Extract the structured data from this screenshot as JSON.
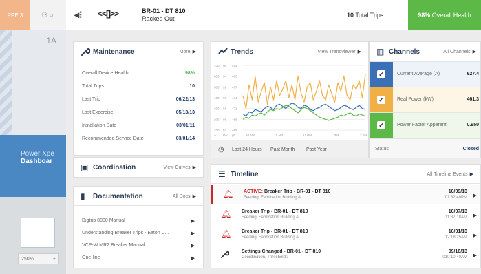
{
  "background": {
    "ppe_label": "PPE 3",
    "tab_icons": "⚇ ○",
    "tile_label": "1A",
    "dashboard_line1": "Power Xpe",
    "dashboard_line2": "Dashboar",
    "zoom_value": "250%",
    "zoom_plus": "+"
  },
  "header": {
    "back_icon": "◂⁝",
    "device_icon": "<<[]>>",
    "device_name": "BR-01 - DT 810",
    "device_status": "Racked Out",
    "total_trips_value": "10",
    "total_trips_label": "Total Trips",
    "health_value": "98%",
    "health_label": "Overall Health",
    "health_color": "#5cb947"
  },
  "maintenance": {
    "title": "Maintenance",
    "link": "More",
    "rows": [
      {
        "label": "Overall Device Health",
        "value": "98%"
      },
      {
        "label": "Total Trips",
        "value": "10"
      },
      {
        "label": "Last Trip",
        "value": "06/22/13"
      },
      {
        "label": "Last Excercise",
        "value": "05/13/13"
      },
      {
        "label": "Installation Date",
        "value": "03/01/11"
      },
      {
        "label": "Recommended Service Date",
        "value": "03/01/14"
      }
    ]
  },
  "coordination": {
    "title": "Coordination",
    "link": "View Curves"
  },
  "documentation": {
    "title": "Documentation",
    "link": "All Docs",
    "items": [
      "Digtrip 8000 Manual",
      "Understanding Breaker Trips - Eaton U...",
      "VCP-W MR2 Breaker Manual",
      "One-line"
    ]
  },
  "trends": {
    "title": "Trends",
    "link": "View Trendviewer",
    "ranges": [
      "Last 24 Hours",
      "Past Month",
      "Past Year"
    ],
    "y_ticks": [
      [
        "700",
        "96",
        "483"
      ],
      [
        "600",
        "94",
        "480"
      ],
      [
        "500",
        "92",
        "477"
      ],
      [
        "400",
        "90",
        "474"
      ],
      [
        "300",
        "88",
        "471"
      ],
      [
        "200",
        "86",
        "468"
      ],
      [
        "100",
        "84",
        "465"
      ]
    ],
    "x_axis_prefix": [
      "A",
      "kW",
      "pf"
    ],
    "x_ticks": [
      "10 AM",
      "11 AM",
      "12 PM",
      "1 PM",
      "2 PM"
    ]
  },
  "chart_data": {
    "type": "line",
    "x": [
      0,
      0.5,
      1,
      1.5,
      2,
      2.5,
      3,
      3.5,
      4,
      4.5,
      5,
      5.5,
      6,
      6.5,
      7,
      7.5,
      8,
      8.5,
      9,
      9.5,
      10,
      10.5,
      11,
      11.5,
      12,
      12.5,
      13,
      13.5,
      14,
      14.5,
      15,
      15.5,
      16,
      16.5,
      17,
      17.5,
      18,
      18.5,
      19,
      19.5,
      20
    ],
    "series": [
      {
        "color": "#f0b046",
        "values": [
          420,
          300,
          520,
          380,
          600,
          360,
          460,
          540,
          340,
          500,
          380,
          560,
          420,
          480,
          560,
          400,
          520,
          380,
          600,
          440,
          360,
          500,
          540,
          380,
          460,
          560,
          420,
          380,
          520,
          440,
          360,
          540,
          460,
          600,
          420,
          380,
          520,
          480,
          560,
          400,
          620
        ]
      },
      {
        "color": "#3b6fb6",
        "values": [
          250,
          230,
          270,
          260,
          290,
          280,
          270,
          300,
          320,
          310,
          290,
          330,
          340,
          320,
          300,
          330,
          350,
          340,
          310,
          300,
          330,
          320,
          290,
          280,
          300,
          310,
          330,
          340,
          320,
          300,
          280,
          290,
          310,
          330,
          320,
          300,
          290,
          310,
          330,
          300,
          290
        ]
      },
      {
        "color": "#5cb947",
        "values": [
          200,
          220,
          210,
          240,
          230,
          250,
          260,
          240,
          270,
          290,
          280,
          300,
          290,
          310,
          330,
          320,
          300,
          280,
          260,
          290,
          310,
          300,
          280,
          260,
          240,
          220,
          210,
          200,
          190,
          200,
          210,
          220,
          240,
          230,
          250,
          260,
          240,
          230,
          250,
          240,
          230
        ]
      }
    ]
  },
  "channels": {
    "title": "Channels",
    "link": "All Channels",
    "items": [
      {
        "label": "Current Average (A)",
        "value": "627.4",
        "color": "#3b6fb6",
        "bg": "#eef3fa"
      },
      {
        "label": "Real Power (kW)",
        "value": "461.3",
        "color": "#f0b046",
        "bg": "#fdf5e6"
      },
      {
        "label": "Power Factor Apparent",
        "value": "0.950",
        "color": "#5cb947",
        "bg": "#eef7ea"
      }
    ],
    "status_label": "Status",
    "status_value": "Closed"
  },
  "timeline": {
    "title": "Timeline",
    "link": "All Timeline Events",
    "events": [
      {
        "prefix": "ACTIVE:",
        "title": "Breaker Trip - BR-01 - DT 810",
        "sub": "Feeding: Fabrication Building A",
        "date": "10/09/13",
        "time": "01:32:40PM",
        "icon": "bell",
        "active": true
      },
      {
        "prefix": "",
        "title": "Breaker Trip - BR-01 - DT 810",
        "sub": "Feeding: Fabrication Building A",
        "date": "10/07/13",
        "time": "11:37:18AM",
        "icon": "bell",
        "active": false
      },
      {
        "prefix": "",
        "title": "Breaker Trip - BR-01 - DT 810",
        "sub": "Feeding: Fabrication Building A",
        "date": "10/01/13",
        "time": "12:18:25AM",
        "icon": "bell",
        "active": false
      },
      {
        "prefix": "",
        "title": "Settings Changed - BR-01 - DT 810",
        "sub": "Coordination, Thresholds",
        "date": "09/16/13",
        "time": "010:10:40AM",
        "icon": "wrench",
        "active": false
      }
    ]
  }
}
